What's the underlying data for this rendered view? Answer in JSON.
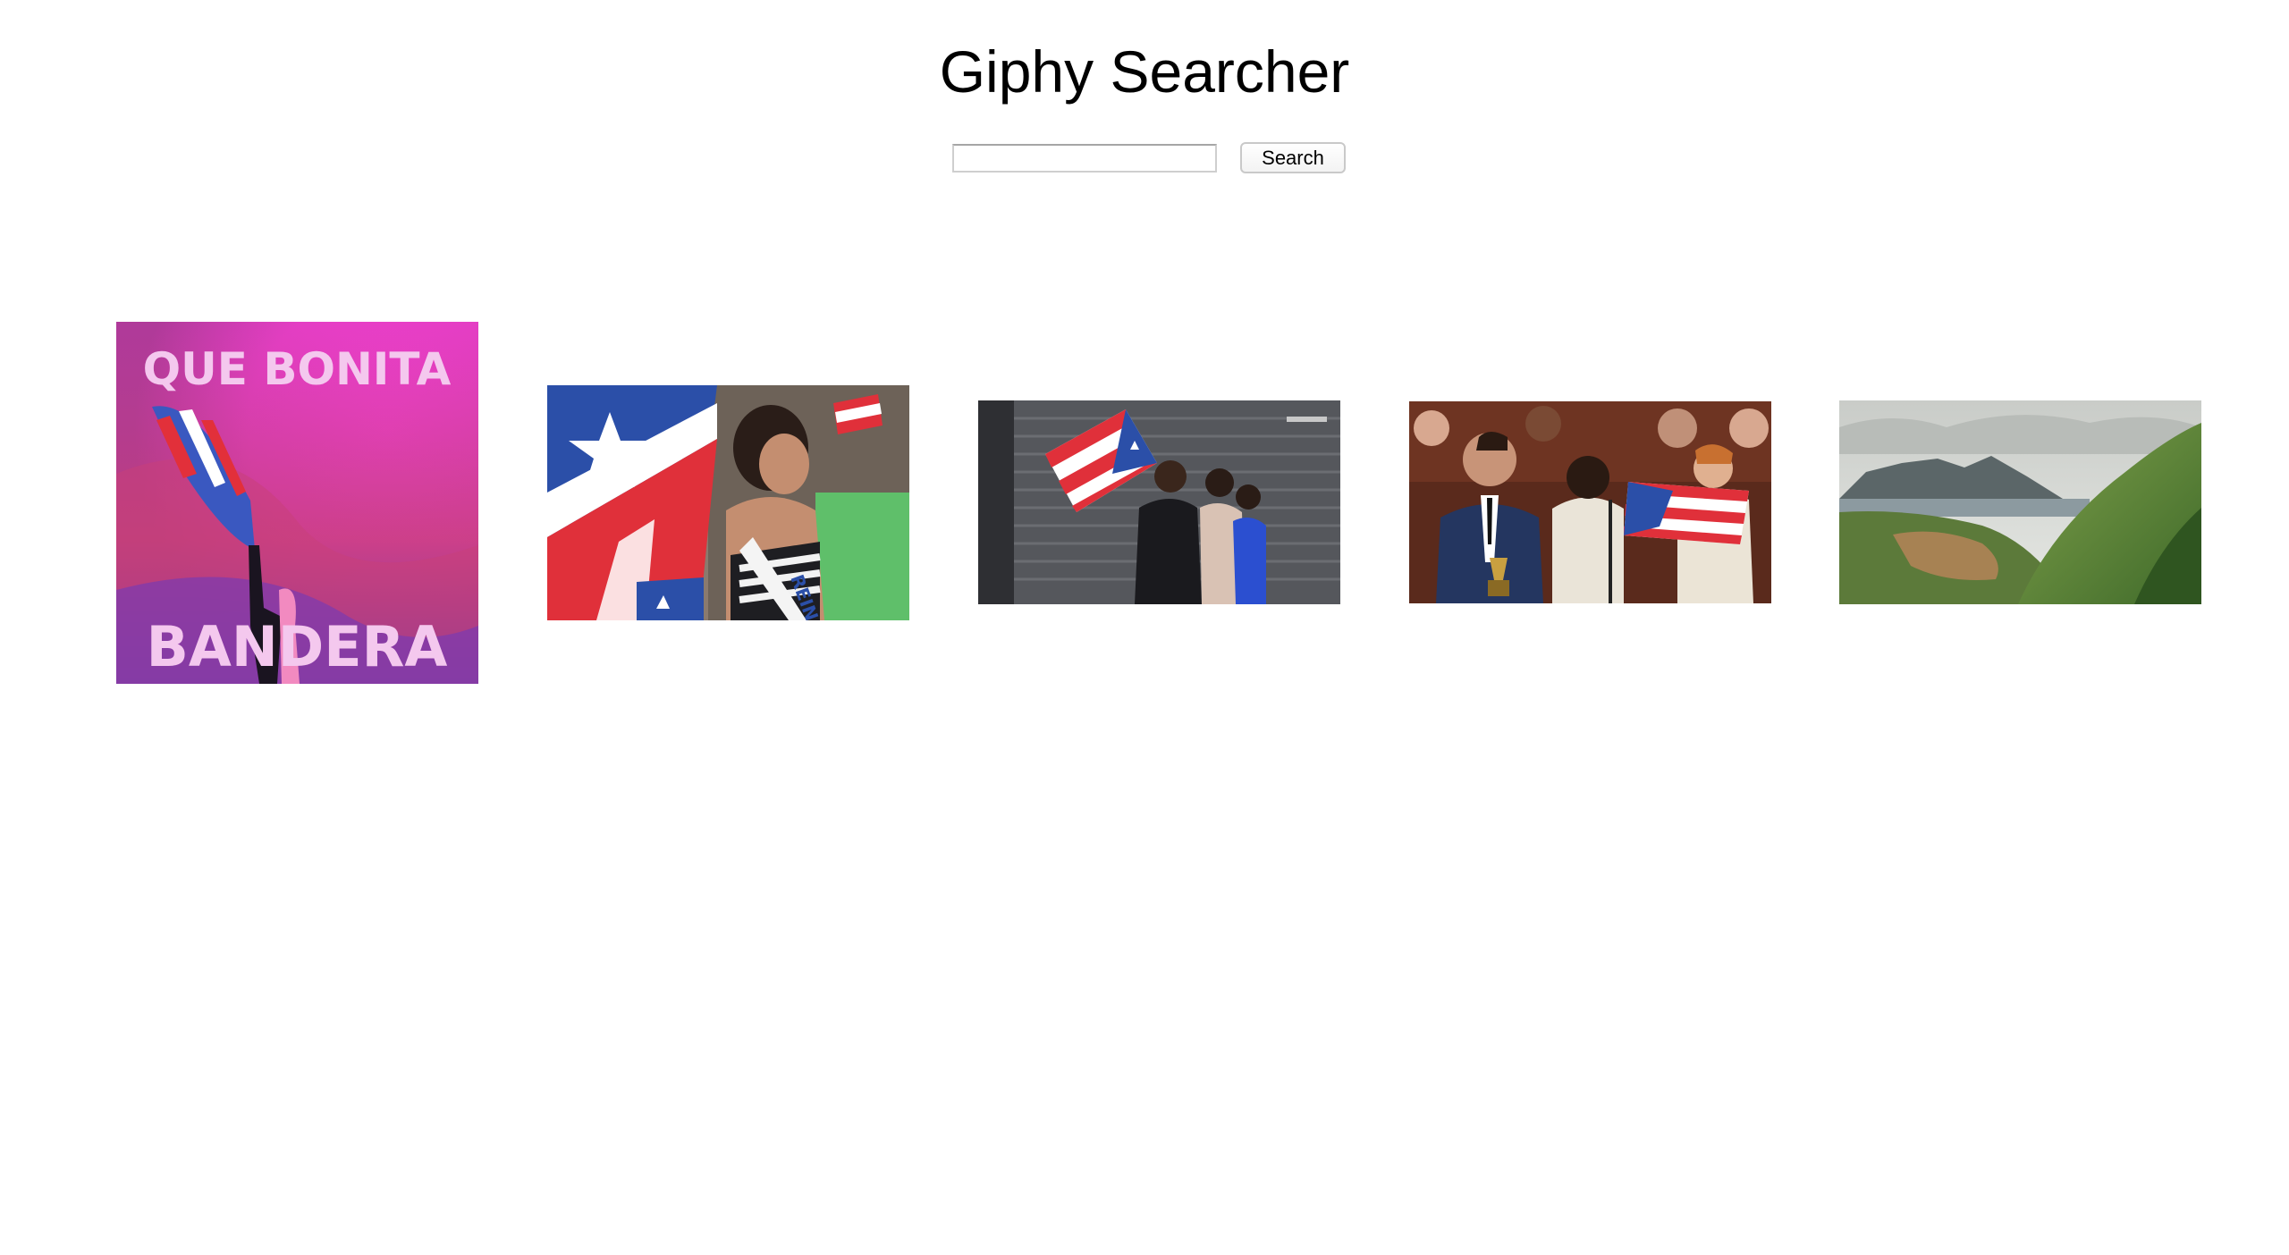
{
  "header": {
    "title": "Giphy Searcher"
  },
  "search": {
    "value": "",
    "placeholder": "",
    "button_label": "Search"
  },
  "results": [
    {
      "name": "gif-que-bonita-bandera",
      "text_top": "QUE BONITA",
      "text_bottom": "BANDERA"
    },
    {
      "name": "gif-parade-flag-woman",
      "sash_text": "REINA"
    },
    {
      "name": "gif-street-flag-walkers"
    },
    {
      "name": "gif-awards-flag-group"
    },
    {
      "name": "gif-coastal-landscape"
    }
  ],
  "colors": {
    "background": "#ffffff",
    "flag_blue": "#2b4fa8",
    "flag_red": "#e0303a",
    "magenta": "#d63ac8"
  }
}
